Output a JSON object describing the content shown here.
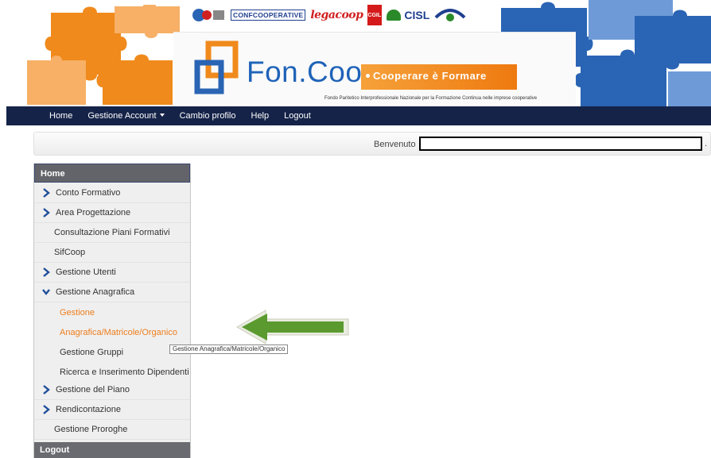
{
  "banner": {
    "partner_logos": [
      "CONFCOOPERATIVE",
      "legacoop",
      "CGIL",
      "CISL"
    ],
    "brand_title": "Fon.Coop",
    "brand_tagline": "Cooperare è Formare",
    "brand_subtitle": "Fondo Paritetico Interprofessionale Nazionale per la Formazione Continua nelle imprese cooperative",
    "colors": {
      "orange": "#f08a1c",
      "blue": "#2a64b4",
      "navbar": "#152348"
    }
  },
  "navbar": {
    "items": [
      {
        "label": "Home"
      },
      {
        "label": "Gestione Account",
        "dropdown": true
      },
      {
        "label": "Cambio profilo"
      },
      {
        "label": "Help"
      },
      {
        "label": "Logout"
      }
    ]
  },
  "welcome": {
    "label": "Benvenuto",
    "suffix": "."
  },
  "sidebar": {
    "header": "Home",
    "footer": "Logout",
    "items": [
      {
        "label": "Conto Formativo",
        "icon": "chevron-right-icon"
      },
      {
        "label": "Area Progettazione",
        "icon": "chevron-right-icon"
      },
      {
        "label": "Consultazione Piani Formativi"
      },
      {
        "label": "SifCoop"
      },
      {
        "label": "Gestione Utenti",
        "icon": "chevron-right-icon"
      },
      {
        "label": "Gestione Anagrafica",
        "icon": "chevron-down-icon"
      },
      {
        "label": "Gestione",
        "active": true
      },
      {
        "label": "Anagrafica/Matricole/Organico",
        "active": true
      },
      {
        "label": "Gestione Gruppi"
      },
      {
        "label": "Ricerca e Inserimento Dipendenti"
      },
      {
        "label": "Gestione del Piano",
        "icon": "chevron-right-icon"
      },
      {
        "label": "Rendicontazione",
        "icon": "chevron-right-icon"
      },
      {
        "label": "Gestione Proroghe"
      }
    ]
  },
  "tooltip": {
    "text": "Gestione Anagrafica/Matricole/Organico"
  },
  "annotation": {
    "arrow_color": "#5a9a2e",
    "arrow_icon": "left-arrow-icon"
  }
}
